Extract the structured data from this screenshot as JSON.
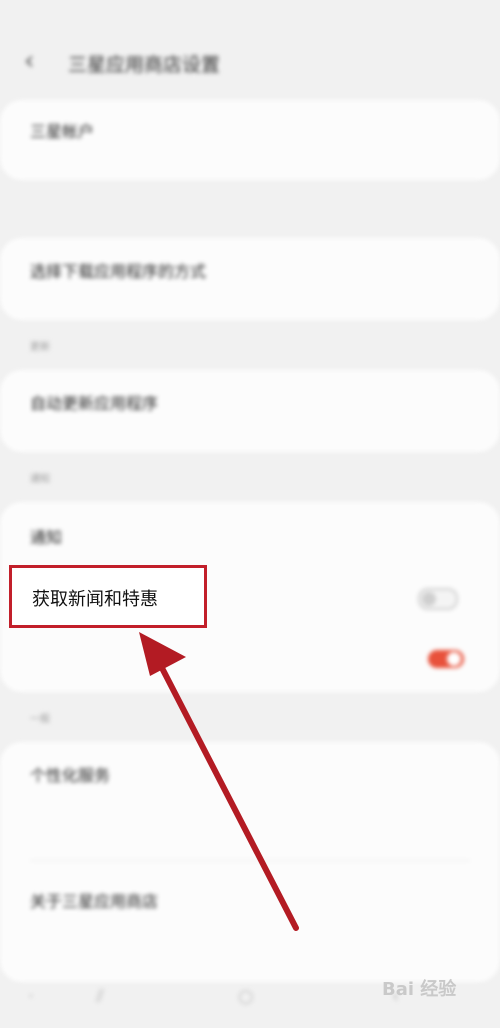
{
  "statusbar": {
    "left": "",
    "right": ""
  },
  "header": {
    "back_label": "‹",
    "title": "三星应用商店设置"
  },
  "account": {
    "title": "三星帐户",
    "subtitle": ""
  },
  "download": {
    "title": "选择下载应用程序的方式",
    "subtitle": ""
  },
  "section_update": {
    "label": "更新"
  },
  "auto_update": {
    "title": "自动更新应用程序",
    "subtitle": ""
  },
  "section_notifications": {
    "label": "通知"
  },
  "notifications": {
    "title": "通知",
    "news_offers": {
      "label": "获取新闻和特惠",
      "enabled": false
    },
    "marketing": {
      "label": "",
      "enabled": true
    }
  },
  "section_general": {
    "label": "一般"
  },
  "personalized": {
    "title": "个性化服务",
    "description": "",
    "subtitle": ""
  },
  "about": {
    "title": "关于三星应用商店"
  },
  "help": {
    "title": ""
  },
  "watermark": {
    "text": "Bai 经验"
  },
  "colors": {
    "accent": "#e8513b",
    "highlight_border": "#c21f2a",
    "arrow": "#b31b23"
  }
}
